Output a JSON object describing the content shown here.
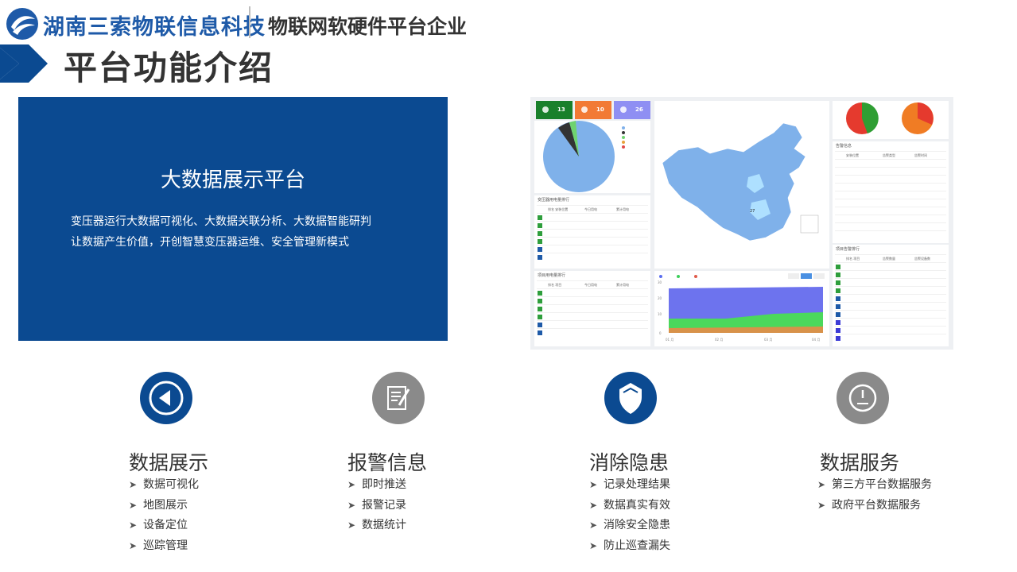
{
  "header": {
    "brand": "湖南三索物联信息科技",
    "tagline": "物联网软硬件平台企业",
    "page_title": "平台功能介绍"
  },
  "panel": {
    "title": "大数据展示平台",
    "desc_line1": "变压器运行大数据可视化、大数据关联分析、大数据智能研判",
    "desc_line2": "让数据产生价值，开创智慧变压器运维、安全管理新模式"
  },
  "dashboard": {
    "stats": [
      "13",
      "10",
      "26"
    ],
    "stat_colors": [
      "#19802b",
      "#f27a35",
      "#8f8ff3"
    ],
    "top_table_title": "变压器用电量排行",
    "bottom_table_title": "项目用电量排行",
    "right_table_title": "项目告警排行",
    "alarm_table_title": "告警信息",
    "area_legend": [
      "在线",
      "在线",
      "告警"
    ],
    "area_buttons": [
      "今天",
      "本月",
      "年度"
    ]
  },
  "features": [
    {
      "title": "数据展示",
      "icon": "play-back-icon",
      "color": "#0b4a91",
      "items": [
        "数据可视化",
        "地图展示",
        "设备定位",
        "巡踪管理"
      ]
    },
    {
      "title": "报警信息",
      "icon": "document-edit-icon",
      "color": "#8a8a8a",
      "items": [
        "即时推送",
        "报警记录",
        "数据统计"
      ]
    },
    {
      "title": "消除隐患",
      "icon": "shield-icon",
      "color": "#0b4a91",
      "items": [
        "记录处理结果",
        "数据真实有效",
        "消除安全隐患",
        "防止巡查漏失"
      ]
    },
    {
      "title": "数据服务",
      "icon": "gauge-icon",
      "color": "#8a8a8a",
      "items": [
        "第三方平台数据服务",
        "政府平台数据服务"
      ]
    }
  ]
}
